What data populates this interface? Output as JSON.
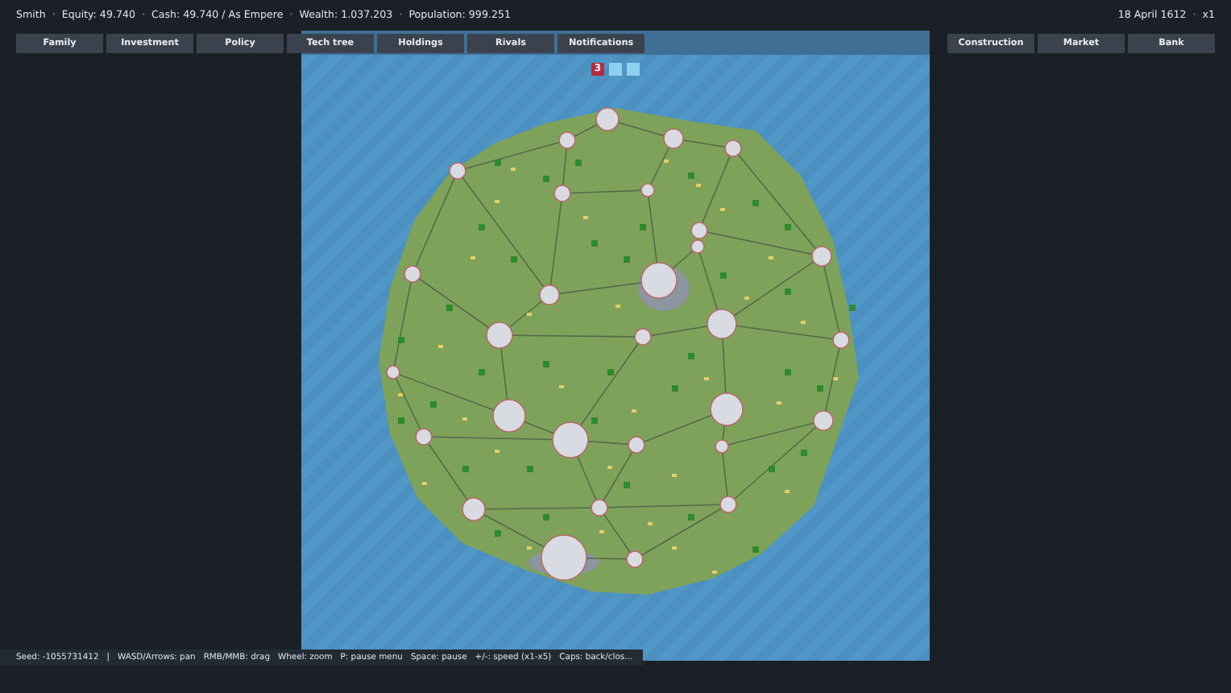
{
  "status": {
    "stats": [
      "Smith",
      "Equity: 49.740",
      "Cash: 49.740 / As Empere",
      "Wealth: 1.037.203",
      "Population: 999.251"
    ],
    "date": "18 April 1612",
    "speed": "x1",
    "separators": [
      "·",
      "·",
      "·",
      "·",
      "·"
    ]
  },
  "left_tabs": [
    {
      "label": "Family"
    },
    {
      "label": "Investment"
    },
    {
      "label": "Policy"
    },
    {
      "label": "Tech tree"
    },
    {
      "label": "Holdings"
    },
    {
      "label": "Rivals"
    },
    {
      "label": "Notifications"
    }
  ],
  "right_tabs": [
    {
      "label": "Construction"
    },
    {
      "label": "Market"
    },
    {
      "label": "Bank"
    }
  ],
  "map_markers": [
    {
      "label": "3",
      "color": "#b32a3f"
    },
    {
      "color": "#8fd0f0"
    },
    {
      "color": "#8fd0f0"
    }
  ],
  "hints": {
    "seed": "Seed: -1055731412",
    "separator": "|",
    "items": [
      "WASD/Arrows: pan",
      "RMB/MMB: drag",
      "Wheel: zoom",
      "P: pause menu",
      "Space: pause",
      "+/-: speed (x1-x5)",
      "Caps: back/clos…"
    ]
  }
}
